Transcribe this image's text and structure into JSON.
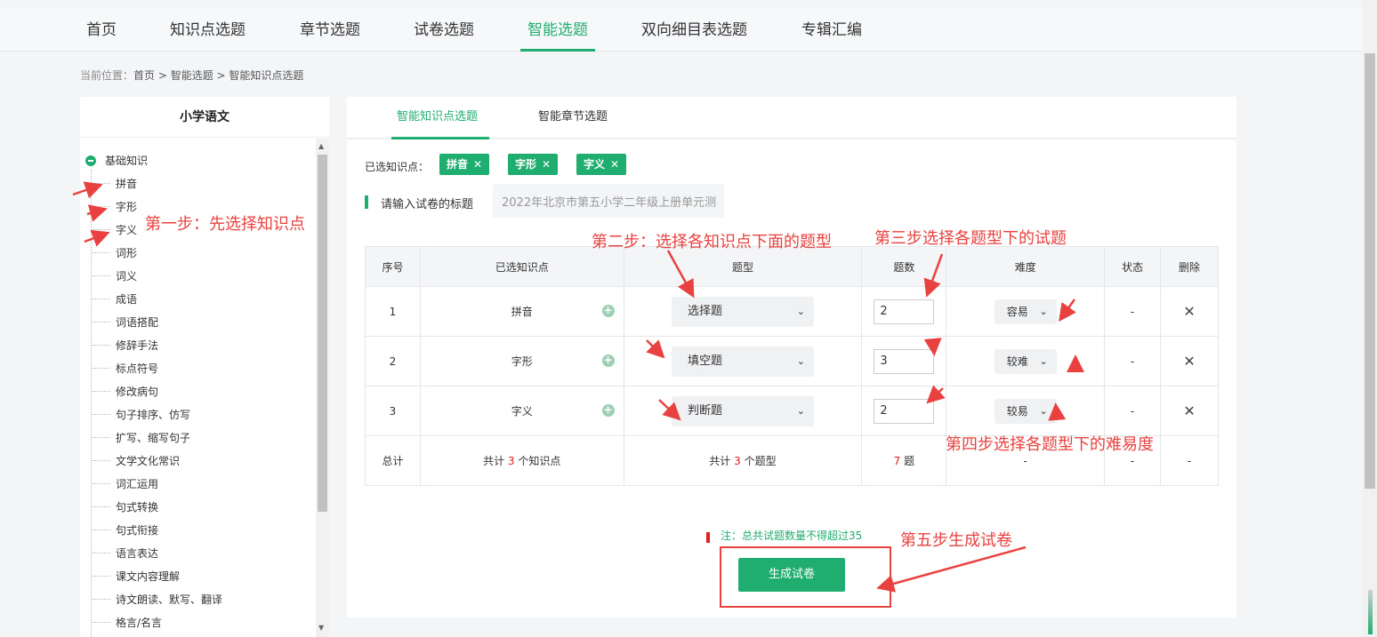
{
  "nav": {
    "items": [
      "首页",
      "知识点选题",
      "章节选题",
      "试卷选题",
      "智能选题",
      "双向细目表选题",
      "专辑汇编"
    ],
    "active": "智能选题"
  },
  "breadcrumb": {
    "label": "当前位置：",
    "path": "首页 > 智能选题 > 智能知识点选题"
  },
  "left": {
    "title": "小学语文",
    "root": "基础知识",
    "items": [
      "拼音",
      "字形",
      "字义",
      "词形",
      "词义",
      "成语",
      "词语搭配",
      "修辞手法",
      "标点符号",
      "修改病句",
      "句子排序、仿写",
      "扩写、缩写句子",
      "文学文化常识",
      "词汇运用",
      "句式转换",
      "句式衔接",
      "语言表达",
      "课文内容理解",
      "诗文朗读、默写、翻译",
      "格言/名言"
    ]
  },
  "main": {
    "tabs": [
      "智能知识点选题",
      "智能章节选题"
    ],
    "selected_label": "已选知识点：",
    "chips": [
      "拼音",
      "字形",
      "字义"
    ],
    "title_label": "请输入试卷的标题",
    "title_value": "2022年北京市第五小学二年级上册单元测",
    "table": {
      "headers": [
        "序号",
        "已选知识点",
        "题型",
        "题数",
        "难度",
        "状态",
        "删除"
      ],
      "rows": [
        {
          "no": "1",
          "kp": "拼音",
          "type": "选择题",
          "count": "2",
          "diff": "容易",
          "status": "-"
        },
        {
          "no": "2",
          "kp": "字形",
          "type": "填空题",
          "count": "3",
          "diff": "较难",
          "status": "-"
        },
        {
          "no": "3",
          "kp": "字义",
          "type": "判断题",
          "count": "2",
          "diff": "较易",
          "status": "-"
        }
      ],
      "total": {
        "label": "总计",
        "kp_pre": "共计",
        "kp_num": "3",
        "kp_post": "个知识点",
        "type_pre": "共计",
        "type_num": "3",
        "type_post": "个题型",
        "count_num": "7",
        "count_post": "题",
        "diff": "-",
        "status": "-",
        "del": "-"
      }
    },
    "note": "注：总共试题数量不得超过35",
    "generate": "生成试卷"
  },
  "annotations": {
    "step1": "第一步：先选择知识点",
    "step2": "第二步：选择各知识点下面的题型",
    "step3": "第三步选择各题型下的试题",
    "step4": "第四步选择各题型下的难易度",
    "step5": "第五步生成试卷"
  },
  "colors": {
    "accent": "#1fae6f",
    "annotation": "#e8413f"
  }
}
